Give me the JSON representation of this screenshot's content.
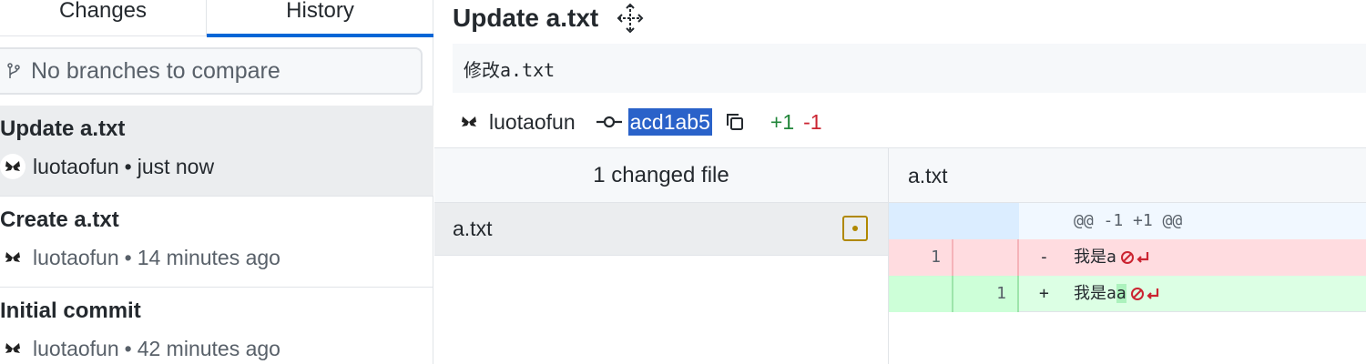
{
  "tabs": {
    "changes": "Changes",
    "history": "History"
  },
  "branch_compare": {
    "placeholder": "No branches to compare"
  },
  "commits": [
    {
      "title": "Update a.txt",
      "author": "luotaofun",
      "time": "just now"
    },
    {
      "title": "Create a.txt",
      "author": "luotaofun",
      "time": "14 minutes ago"
    },
    {
      "title": "Initial commit",
      "author": "luotaofun",
      "time": "42 minutes ago"
    }
  ],
  "meta_separator": "•",
  "detail": {
    "summary": "Update a.txt",
    "description": "修改a.txt",
    "author": "luotaofun",
    "sha": "acd1ab5",
    "additions": "+1",
    "deletions": "-1"
  },
  "files": {
    "header": "1 changed file",
    "items": [
      {
        "name": "a.txt",
        "status": "modified"
      }
    ]
  },
  "diff": {
    "file": "a.txt",
    "hunk": "@@ -1 +1 @@",
    "lines": [
      {
        "type": "del",
        "old": "1",
        "new": "",
        "sign": "-",
        "text": "我是a",
        "highlight": ""
      },
      {
        "type": "add",
        "old": "",
        "new": "1",
        "sign": "+",
        "text": "我是a",
        "highlight": "a"
      }
    ]
  },
  "colors": {
    "accent": "#0366d6",
    "added": "#22863a",
    "deleted": "#cb2431",
    "modified": "#b08800",
    "sha_highlight": "#2a62c9"
  },
  "icons": [
    "branch-icon",
    "avatar-icon",
    "move-icon",
    "commit-icon",
    "copy-icon",
    "file-modified-icon",
    "no-newline-icon"
  ]
}
